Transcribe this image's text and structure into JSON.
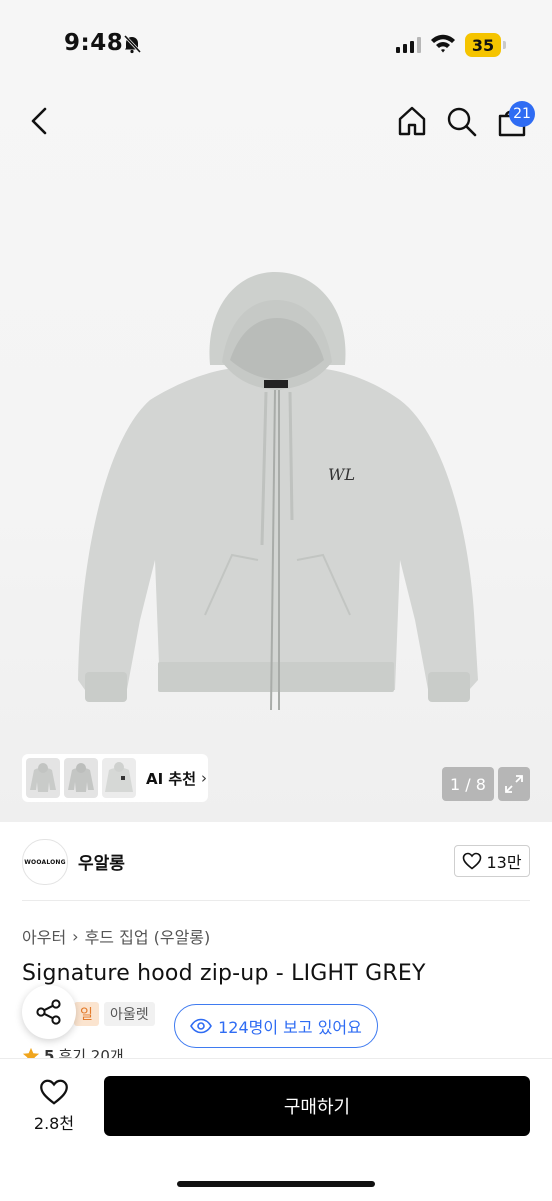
{
  "status_bar": {
    "time": "9:48",
    "battery": "35"
  },
  "nav": {
    "cart_count": "21"
  },
  "gallery": {
    "ai_label": "AI 추천",
    "pager": "1 / 8",
    "logo_text": "WL"
  },
  "shop": {
    "logo_text": "WOOALONG",
    "name": "우알롱",
    "likes": "13만"
  },
  "breadcrumb": {
    "level1": "아우터",
    "level2": "후드 집업 (우알롱)"
  },
  "product": {
    "title": "Signature hood zip-up - LIGHT GREY",
    "tag_sale": "일",
    "tag_outlet": "아울렛",
    "viewers": "124명이 보고 있어요",
    "rating": "5",
    "reviews": "후기 20개"
  },
  "bottom": {
    "wish_count": "2.8천",
    "buy_label": "구매하기"
  },
  "colors": {
    "accent": "#2f6cf3",
    "buy": "#000000",
    "battery": "#f5c400",
    "hoodie": "#d3d5d3"
  },
  "icons": [
    "bell-slash-icon",
    "signal-icon",
    "wifi-icon",
    "back-icon",
    "home-icon",
    "search-icon",
    "cart-icon",
    "chevron-right-icon",
    "expand-icon",
    "heart-icon",
    "eye-icon",
    "share-icon",
    "star-icon"
  ]
}
